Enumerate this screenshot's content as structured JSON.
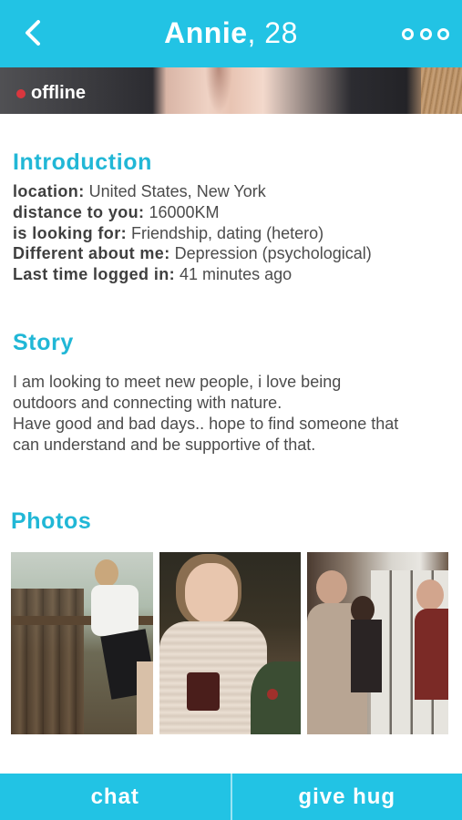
{
  "header": {
    "name": "Annie",
    "age": ", 28",
    "back_icon": "chevron-left-icon",
    "more_icon": "more-dots-icon"
  },
  "hero": {
    "status": "offline",
    "status_color": "#d9363e"
  },
  "introduction": {
    "heading": "Introduction",
    "rows": [
      {
        "label": "location:",
        "value": "United States, New York"
      },
      {
        "label": "distance to you:",
        "value": "16000KM"
      },
      {
        "label": "is looking for:",
        "value": "Friendship, dating (hetero)"
      },
      {
        "label": "Different about me:",
        "value": "Depression (psychological)"
      },
      {
        "label": "Last time logged in:",
        "value": "41 minutes ago"
      }
    ]
  },
  "story": {
    "heading": "Story",
    "lines": [
      "I am looking to meet new people, i love being",
      "outdoors and connecting with nature.",
      "Have good and bad days.. hope to find someone that",
      "can understand and be supportive of that."
    ]
  },
  "photos": {
    "heading": "Photos",
    "count": 3
  },
  "actions": {
    "chat_label": "chat",
    "hug_label": "give hug"
  },
  "colors": {
    "accent": "#22c3e4",
    "heading": "#21b7d6"
  }
}
